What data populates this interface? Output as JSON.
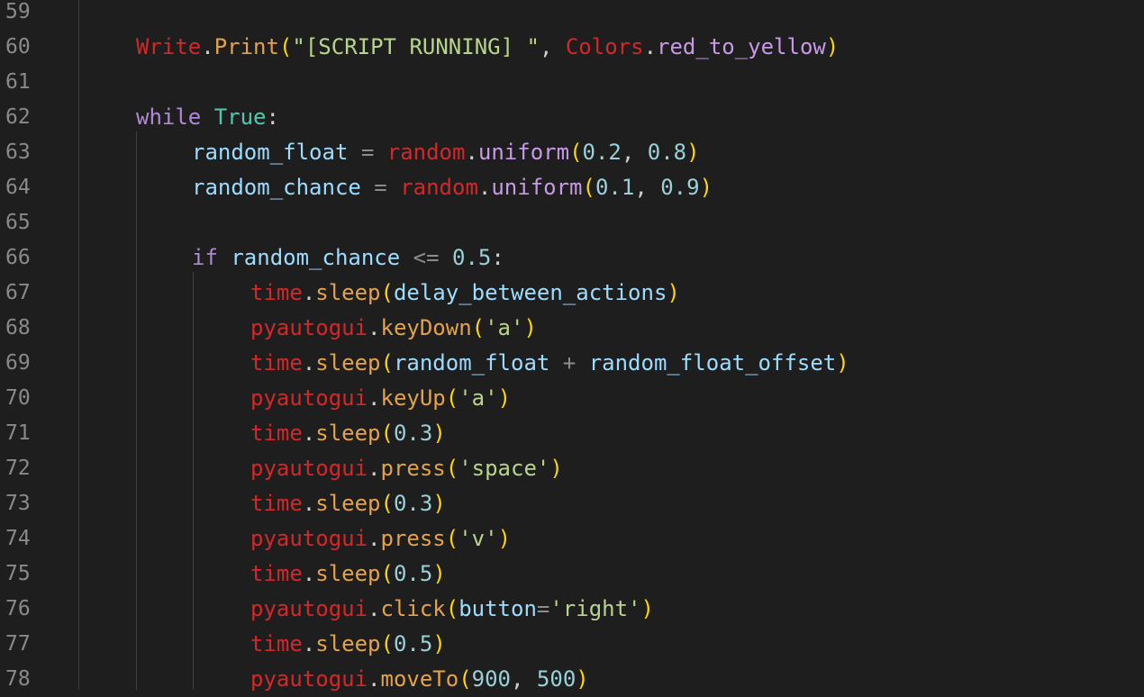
{
  "editor": {
    "theme_colors": {
      "background": "#1e1e1e",
      "line_number": "#8a8a8a",
      "module": "#d3282a",
      "function": "#e27a25",
      "string": "#b9d58b",
      "number": "#9ad0d8",
      "keyword": "#b188d6",
      "bracket": "#ffd700"
    },
    "lines": [
      {
        "number": "59",
        "indent": 0,
        "tokens": []
      },
      {
        "number": "60",
        "indent": 1,
        "tokens": [
          {
            "t": "Write",
            "c": "module"
          },
          {
            "t": ".",
            "c": "punc"
          },
          {
            "t": "Print",
            "c": "method"
          },
          {
            "t": "(",
            "c": "paren"
          },
          {
            "t": "\"[SCRIPT RUNNING] \"",
            "c": "str"
          },
          {
            "t": ", ",
            "c": "punc"
          },
          {
            "t": "Colors",
            "c": "module"
          },
          {
            "t": ".",
            "c": "punc"
          },
          {
            "t": "red_to_yellow",
            "c": "method2"
          },
          {
            "t": ")",
            "c": "paren"
          }
        ]
      },
      {
        "number": "61",
        "indent": 0,
        "tokens": []
      },
      {
        "number": "62",
        "indent": 1,
        "tokens": [
          {
            "t": "while",
            "c": "kw"
          },
          {
            "t": " ",
            "c": "plain"
          },
          {
            "t": "True",
            "c": "bool"
          },
          {
            "t": ":",
            "c": "punc"
          }
        ]
      },
      {
        "number": "63",
        "indent": 2,
        "tokens": [
          {
            "t": "random_float",
            "c": "var"
          },
          {
            "t": " = ",
            "c": "op"
          },
          {
            "t": "random",
            "c": "module"
          },
          {
            "t": ".",
            "c": "punc"
          },
          {
            "t": "uniform",
            "c": "method2"
          },
          {
            "t": "(",
            "c": "paren"
          },
          {
            "t": "0.2",
            "c": "num"
          },
          {
            "t": ", ",
            "c": "punc"
          },
          {
            "t": "0.8",
            "c": "num"
          },
          {
            "t": ")",
            "c": "paren"
          }
        ]
      },
      {
        "number": "64",
        "indent": 2,
        "tokens": [
          {
            "t": "random_chance",
            "c": "var"
          },
          {
            "t": " = ",
            "c": "op"
          },
          {
            "t": "random",
            "c": "module"
          },
          {
            "t": ".",
            "c": "punc"
          },
          {
            "t": "uniform",
            "c": "method2"
          },
          {
            "t": "(",
            "c": "paren"
          },
          {
            "t": "0.1",
            "c": "num"
          },
          {
            "t": ", ",
            "c": "punc"
          },
          {
            "t": "0.9",
            "c": "num"
          },
          {
            "t": ")",
            "c": "paren"
          }
        ]
      },
      {
        "number": "65",
        "indent": 0,
        "tokens": []
      },
      {
        "number": "66",
        "indent": 2,
        "tokens": [
          {
            "t": "if",
            "c": "kw"
          },
          {
            "t": " ",
            "c": "plain"
          },
          {
            "t": "random_chance",
            "c": "var"
          },
          {
            "t": " <= ",
            "c": "op"
          },
          {
            "t": "0.5",
            "c": "num"
          },
          {
            "t": ":",
            "c": "punc"
          }
        ]
      },
      {
        "number": "67",
        "indent": 3,
        "tokens": [
          {
            "t": "time",
            "c": "module"
          },
          {
            "t": ".",
            "c": "punc"
          },
          {
            "t": "sleep",
            "c": "method"
          },
          {
            "t": "(",
            "c": "paren"
          },
          {
            "t": "delay_between_actions",
            "c": "var"
          },
          {
            "t": ")",
            "c": "paren"
          }
        ]
      },
      {
        "number": "68",
        "indent": 3,
        "tokens": [
          {
            "t": "pyautogui",
            "c": "module"
          },
          {
            "t": ".",
            "c": "punc"
          },
          {
            "t": "keyDown",
            "c": "method"
          },
          {
            "t": "(",
            "c": "paren"
          },
          {
            "t": "'a'",
            "c": "str"
          },
          {
            "t": ")",
            "c": "paren"
          }
        ]
      },
      {
        "number": "69",
        "indent": 3,
        "tokens": [
          {
            "t": "time",
            "c": "module"
          },
          {
            "t": ".",
            "c": "punc"
          },
          {
            "t": "sleep",
            "c": "method"
          },
          {
            "t": "(",
            "c": "paren"
          },
          {
            "t": "random_float",
            "c": "var"
          },
          {
            "t": " + ",
            "c": "op"
          },
          {
            "t": "random_float_offset",
            "c": "var"
          },
          {
            "t": ")",
            "c": "paren"
          }
        ]
      },
      {
        "number": "70",
        "indent": 3,
        "tokens": [
          {
            "t": "pyautogui",
            "c": "module"
          },
          {
            "t": ".",
            "c": "punc"
          },
          {
            "t": "keyUp",
            "c": "method"
          },
          {
            "t": "(",
            "c": "paren"
          },
          {
            "t": "'a'",
            "c": "str"
          },
          {
            "t": ")",
            "c": "paren"
          }
        ]
      },
      {
        "number": "71",
        "indent": 3,
        "tokens": [
          {
            "t": "time",
            "c": "module"
          },
          {
            "t": ".",
            "c": "punc"
          },
          {
            "t": "sleep",
            "c": "method"
          },
          {
            "t": "(",
            "c": "paren"
          },
          {
            "t": "0.3",
            "c": "num"
          },
          {
            "t": ")",
            "c": "paren"
          }
        ]
      },
      {
        "number": "72",
        "indent": 3,
        "tokens": [
          {
            "t": "pyautogui",
            "c": "module"
          },
          {
            "t": ".",
            "c": "punc"
          },
          {
            "t": "press",
            "c": "method"
          },
          {
            "t": "(",
            "c": "paren"
          },
          {
            "t": "'space'",
            "c": "str"
          },
          {
            "t": ")",
            "c": "paren"
          }
        ]
      },
      {
        "number": "73",
        "indent": 3,
        "tokens": [
          {
            "t": "time",
            "c": "module"
          },
          {
            "t": ".",
            "c": "punc"
          },
          {
            "t": "sleep",
            "c": "method"
          },
          {
            "t": "(",
            "c": "paren"
          },
          {
            "t": "0.3",
            "c": "num"
          },
          {
            "t": ")",
            "c": "paren"
          }
        ]
      },
      {
        "number": "74",
        "indent": 3,
        "tokens": [
          {
            "t": "pyautogui",
            "c": "module"
          },
          {
            "t": ".",
            "c": "punc"
          },
          {
            "t": "press",
            "c": "method"
          },
          {
            "t": "(",
            "c": "paren"
          },
          {
            "t": "'v'",
            "c": "str"
          },
          {
            "t": ")",
            "c": "paren"
          }
        ]
      },
      {
        "number": "75",
        "indent": 3,
        "tokens": [
          {
            "t": "time",
            "c": "module"
          },
          {
            "t": ".",
            "c": "punc"
          },
          {
            "t": "sleep",
            "c": "method"
          },
          {
            "t": "(",
            "c": "paren"
          },
          {
            "t": "0.5",
            "c": "num"
          },
          {
            "t": ")",
            "c": "paren"
          }
        ]
      },
      {
        "number": "76",
        "indent": 3,
        "tokens": [
          {
            "t": "pyautogui",
            "c": "module"
          },
          {
            "t": ".",
            "c": "punc"
          },
          {
            "t": "click",
            "c": "method"
          },
          {
            "t": "(",
            "c": "paren"
          },
          {
            "t": "button",
            "c": "param"
          },
          {
            "t": "=",
            "c": "op"
          },
          {
            "t": "'right'",
            "c": "str"
          },
          {
            "t": ")",
            "c": "paren"
          }
        ]
      },
      {
        "number": "77",
        "indent": 3,
        "tokens": [
          {
            "t": "time",
            "c": "module"
          },
          {
            "t": ".",
            "c": "punc"
          },
          {
            "t": "sleep",
            "c": "method"
          },
          {
            "t": "(",
            "c": "paren"
          },
          {
            "t": "0.5",
            "c": "num"
          },
          {
            "t": ")",
            "c": "paren"
          }
        ]
      },
      {
        "number": "78",
        "indent": 3,
        "tokens": [
          {
            "t": "pyautogui",
            "c": "module"
          },
          {
            "t": ".",
            "c": "punc"
          },
          {
            "t": "moveTo",
            "c": "method"
          },
          {
            "t": "(",
            "c": "paren"
          },
          {
            "t": "900",
            "c": "num"
          },
          {
            "t": ", ",
            "c": "punc"
          },
          {
            "t": "500",
            "c": "num"
          },
          {
            "t": ")",
            "c": "paren"
          }
        ]
      }
    ]
  }
}
